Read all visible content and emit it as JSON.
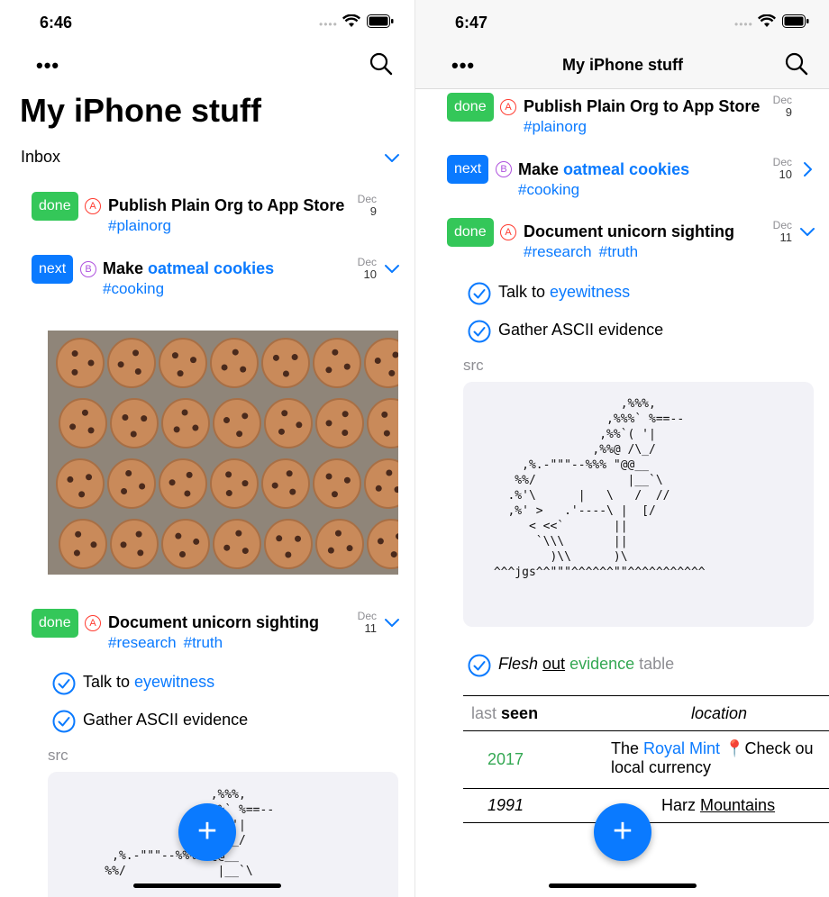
{
  "left": {
    "status": {
      "time": "6:46"
    },
    "nav": {
      "more": "•••"
    },
    "large_title": "My iPhone stuff",
    "section": "Inbox",
    "items": [
      {
        "state": "done",
        "priority": "A",
        "title": "Publish Plain Org to App Store",
        "tags": [
          "#plainorg"
        ],
        "month": "Dec",
        "day": "9"
      },
      {
        "state": "next",
        "priority": "B",
        "title_prefix": "Make ",
        "title_link": "oatmeal cookies",
        "tags": [
          "#cooking"
        ],
        "month": "Dec",
        "day": "10"
      },
      {
        "state": "done",
        "priority": "A",
        "title": "Document unicorn sighting",
        "tags": [
          "#research",
          "#truth"
        ],
        "month": "Dec",
        "day": "11"
      }
    ],
    "subitems": [
      {
        "text": "Talk to ",
        "link": "eyewitness"
      },
      {
        "text": "Gather ASCII evidence"
      }
    ],
    "src_label": "src",
    "ascii": "                   ,%%%,\n                 ,%%%` %==--\n                ,%%`( '|\n               ,%%@ /\\_/\n     ,%.-\"\"\"--%%% \"@@__\n    %%/             |__`\\",
    "fab": "+"
  },
  "right": {
    "status": {
      "time": "6:47"
    },
    "nav": {
      "more": "•••",
      "title": "My iPhone stuff"
    },
    "items": [
      {
        "state": "done",
        "priority": "A",
        "title": "Publish Plain Org to App Store",
        "tags": [
          "#plainorg"
        ],
        "month": "Dec",
        "day": "9"
      },
      {
        "state": "next",
        "priority": "B",
        "title_prefix": "Make ",
        "title_link": "oatmeal cookies",
        "tags": [
          "#cooking"
        ],
        "month": "Dec",
        "day": "10"
      },
      {
        "state": "done",
        "priority": "A",
        "title": "Document unicorn sighting",
        "tags": [
          "#research",
          "#truth"
        ],
        "month": "Dec",
        "day": "11"
      }
    ],
    "subitems": [
      {
        "text": "Talk to ",
        "link": "eyewitness"
      },
      {
        "text": "Gather ASCII evidence"
      }
    ],
    "src_label": "src",
    "ascii": "                   ,%%%,\n                 ,%%%` %==--\n                ,%%`( '|\n               ,%%@ /\\_/\n     ,%.-\"\"\"--%%% \"@@__\n    %%/             |__`\\\n   .%'\\      |   \\   /  //\n   ,%' >   .'----\\ |  [/\n      < <<`       ||\n       `\\\\\\       ||\n         )\\\\      )\\\n ^^^jgs^^\"\"\"^^^^^^\"\"^^^^^^^^^^^",
    "flesh": {
      "w1": "Flesh",
      "w2": "out",
      "w3": "evidence",
      "w4": "table"
    },
    "table": {
      "headers": {
        "last": "last",
        "seen": "seen",
        "location": "location"
      },
      "rows": [
        {
          "year": "2017",
          "loc_prefix": "The ",
          "loc_link": "Royal Mint",
          "loc_pin": "📍",
          "loc_suffix": "Check ou",
          "loc_line2": "local currency"
        },
        {
          "year": "1991",
          "loc_prefix": "Harz ",
          "loc_underline": "Mountains"
        }
      ]
    },
    "fab": "+"
  },
  "colors": {
    "accent": "#0a7aff",
    "done": "#34c759",
    "prio_a": "#ff3b30",
    "prio_b": "#af52de",
    "green_text": "#34a853"
  }
}
